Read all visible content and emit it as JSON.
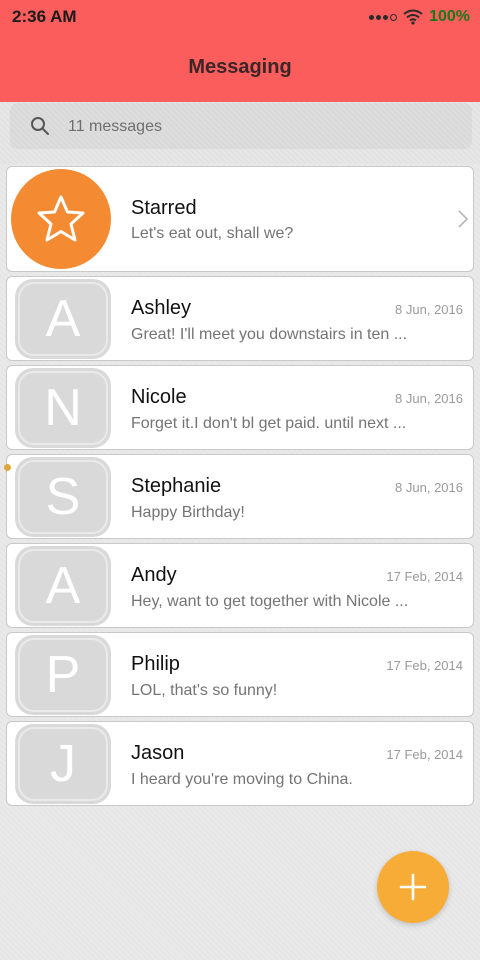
{
  "status": {
    "time": "2:36 AM",
    "battery": "100%"
  },
  "header": {
    "title": "Messaging"
  },
  "search": {
    "placeholder": "11 messages"
  },
  "starred": {
    "name": "Starred",
    "preview": "Let's eat out, shall we?"
  },
  "conversations": [
    {
      "initial": "A",
      "name": "Ashley",
      "date": "8 Jun, 2016",
      "preview": "Great! I'll meet you downstairs in ten ...",
      "unread": false
    },
    {
      "initial": "N",
      "name": "Nicole",
      "date": "8 Jun, 2016",
      "preview": "Forget it.I don't bl get paid. until next ...",
      "unread": false
    },
    {
      "initial": "S",
      "name": "Stephanie",
      "date": "8 Jun, 2016",
      "preview": "Happy Birthday!",
      "unread": true
    },
    {
      "initial": "A",
      "name": "Andy",
      "date": "17 Feb, 2014",
      "preview": "Hey, want to get together with Nicole ...",
      "unread": false
    },
    {
      "initial": "P",
      "name": "Philip",
      "date": "17 Feb, 2014",
      "preview": "LOL, that's so funny!",
      "unread": false
    },
    {
      "initial": "J",
      "name": "Jason",
      "date": "17 Feb, 2014",
      "preview": "I heard you're moving to China.",
      "unread": false
    }
  ],
  "colors": {
    "header": "#fb5d5c",
    "starred_avatar": "#f48b33",
    "fab": "#f7ac37",
    "avatar_bg": "#d9d9d9"
  },
  "icons": {
    "search": "search-icon",
    "star": "star-icon",
    "chevron": "chevron-right-icon",
    "compose": "plus-icon"
  }
}
